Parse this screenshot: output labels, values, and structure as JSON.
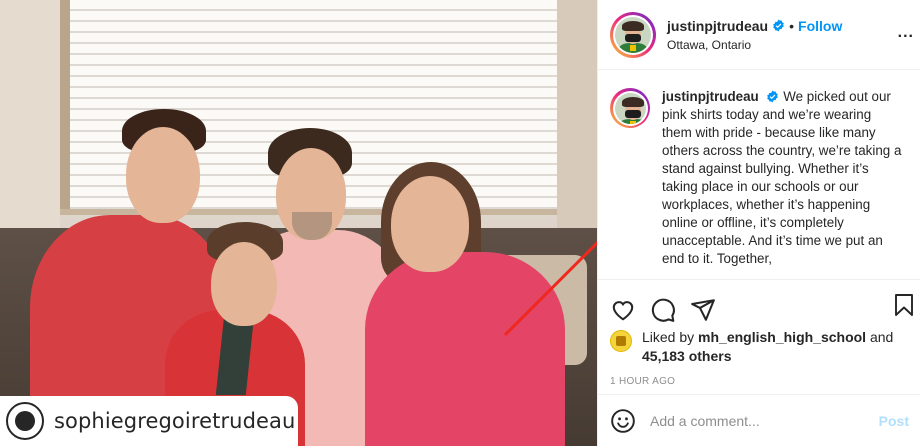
{
  "photo": {
    "tagged_account": "sophiegregoiretrudeau",
    "arrow_color": "#f0281e"
  },
  "post": {
    "header": {
      "username": "justinpjtrudeau",
      "separator": "•",
      "follow_label": "Follow",
      "location": "Ottawa, Ontario",
      "more_label": "..."
    },
    "caption": {
      "username": "justinpjtrudeau",
      "text": "We picked out our pink shirts today and we’re wearing them with pride - because like many others across the country, we’re taking a stand against bullying. Whether it’s taking place in our schools or our workplaces, whether it’s happening online or offline, it’s completely unacceptable. And it’s time we put an end to it. Together,"
    },
    "actions": {
      "like_icon": "heart-icon",
      "comment_icon": "comment-icon",
      "share_icon": "share-icon",
      "save_icon": "bookmark-icon"
    },
    "likes": {
      "prefix": "Liked by",
      "liker": "mh_english_high_school",
      "conjunction": "and",
      "count": "45,183 others"
    },
    "timestamp": "1 HOUR AGO",
    "comment": {
      "placeholder": "Add a comment...",
      "post_label": "Post"
    }
  },
  "colors": {
    "accent_blue": "#0095f6",
    "post_disabled": "#b2dffc",
    "muted_text": "#8e8e8e",
    "border": "#efefef"
  }
}
